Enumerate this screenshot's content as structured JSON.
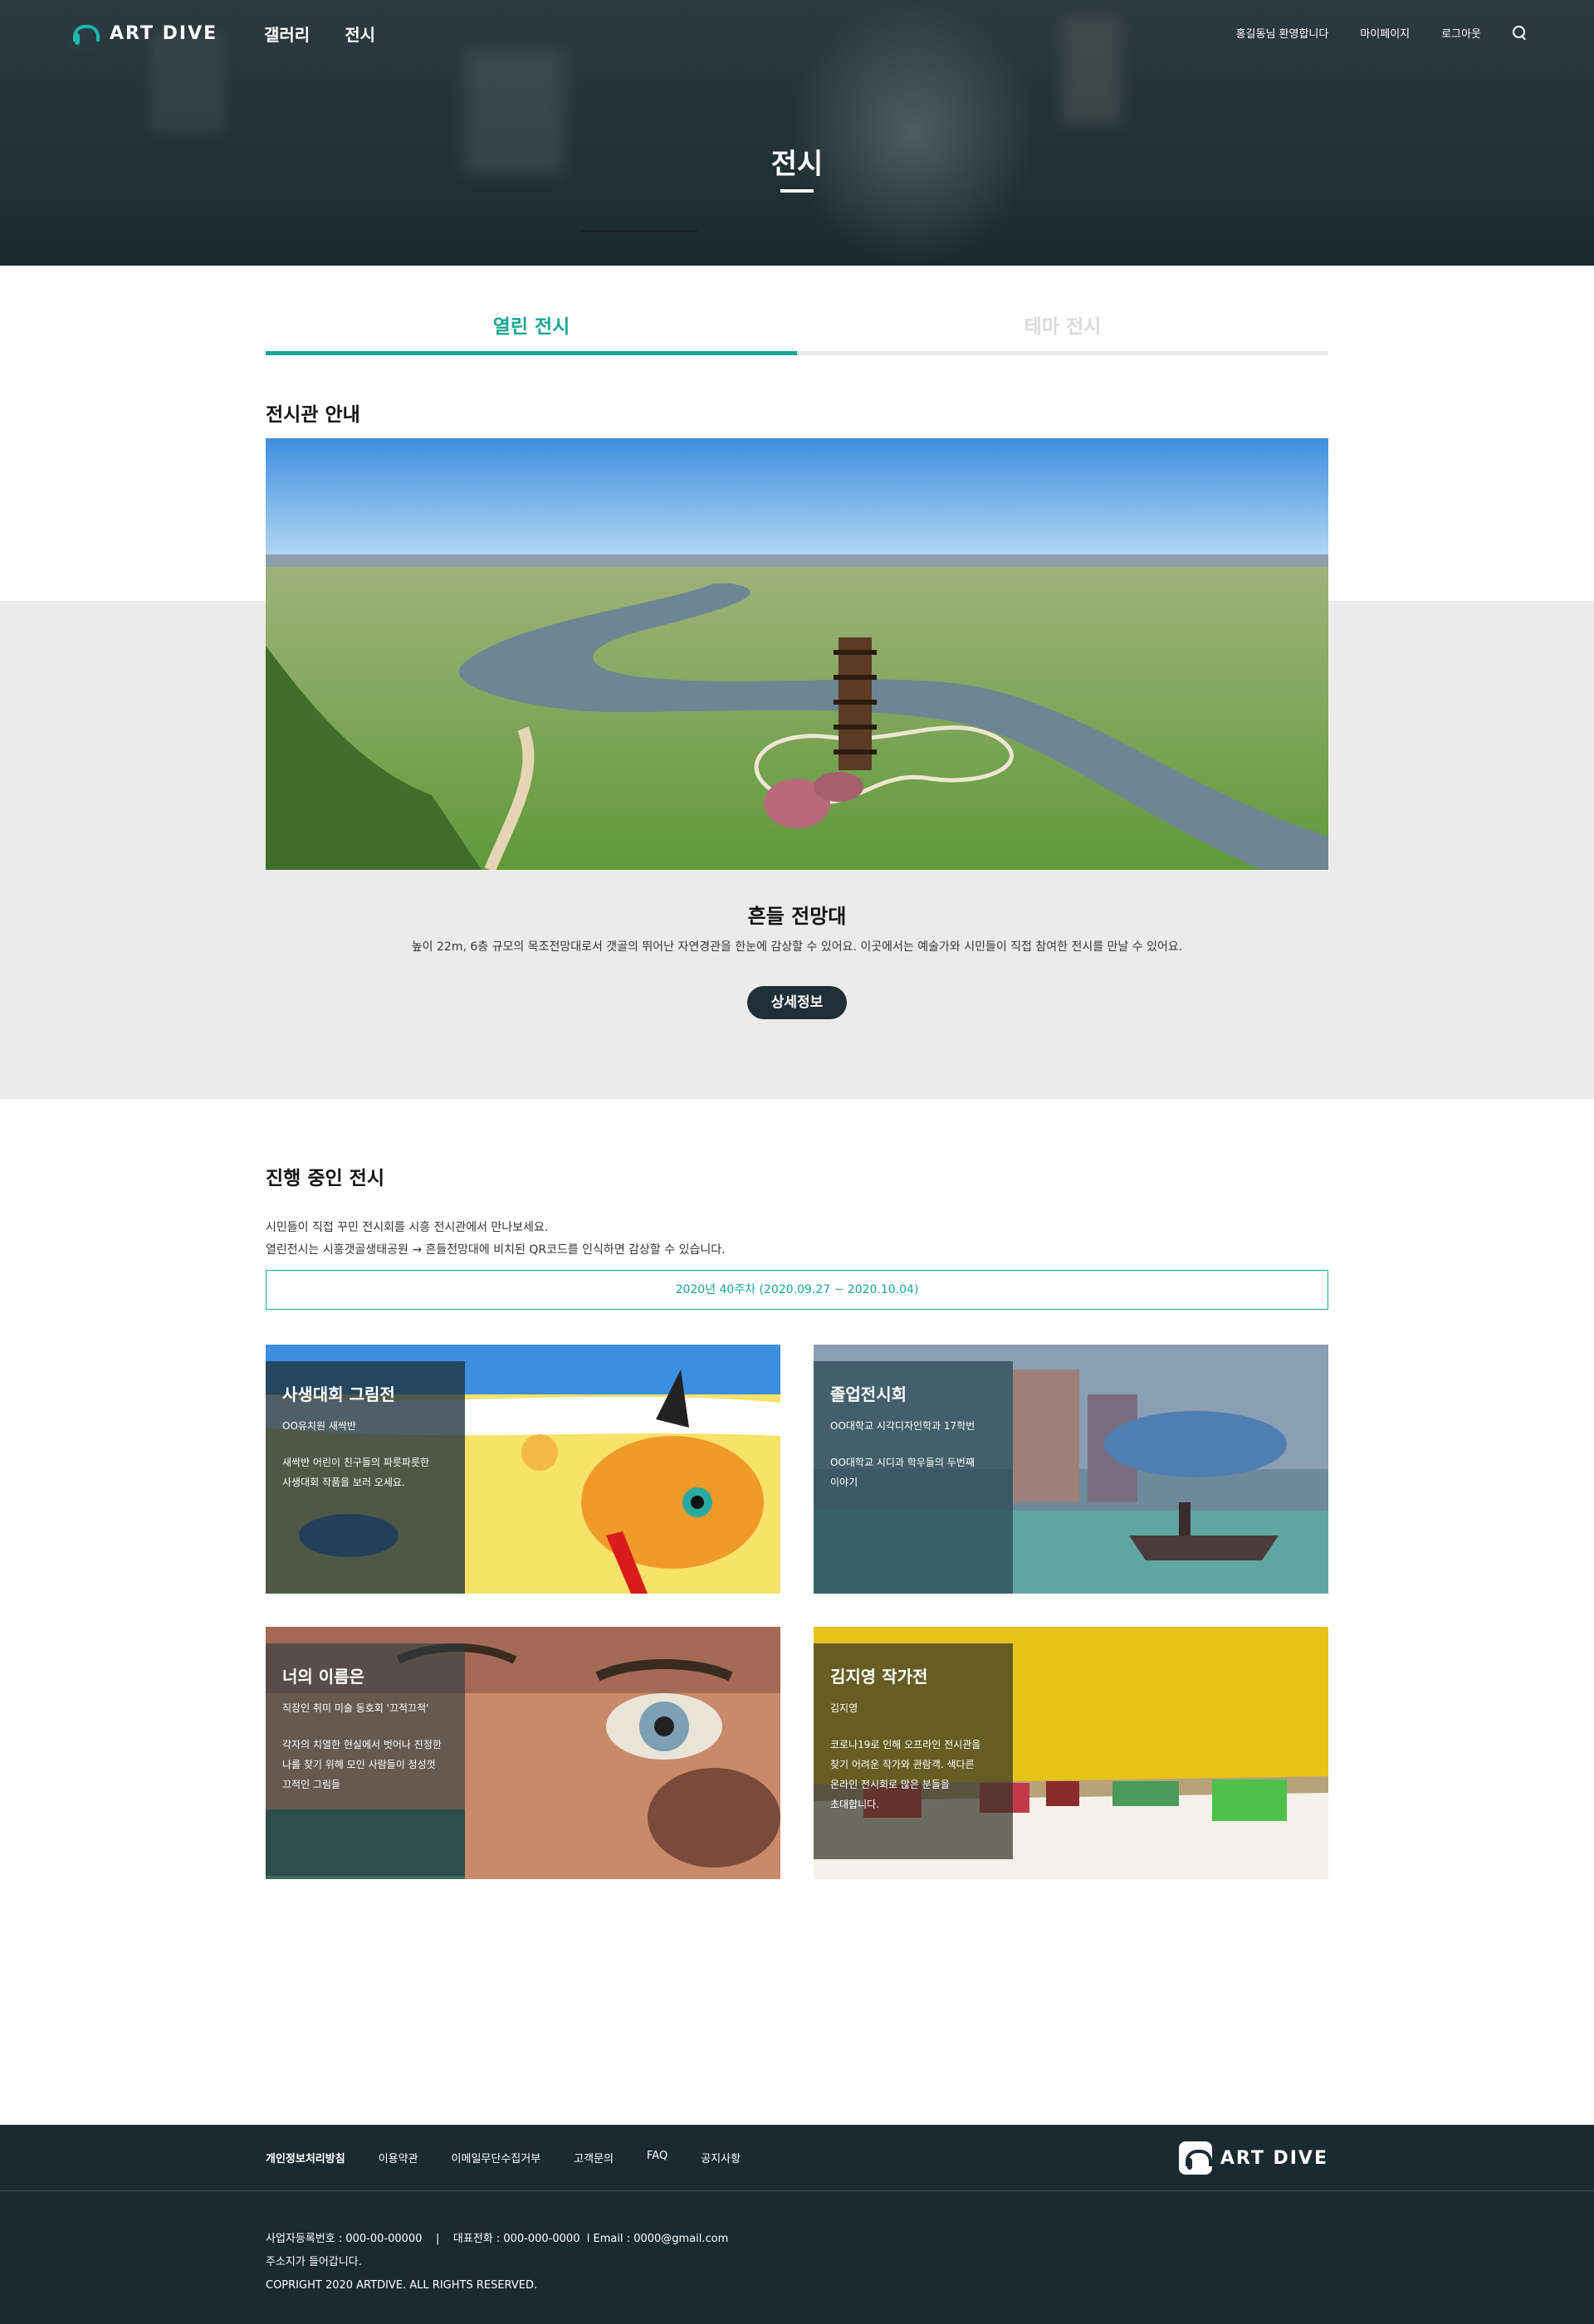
{
  "header": {
    "logo_text": "ART DIVE",
    "nav": [
      "갤러리",
      "전시"
    ],
    "util": {
      "welcome": "홍길동님 환영합니다",
      "mypage": "마이페이지",
      "logout": "로그아웃"
    },
    "hero_title": "전시"
  },
  "tabs": [
    {
      "label": "열린 전시",
      "active": true
    },
    {
      "label": "테마 전시",
      "active": false
    }
  ],
  "hall": {
    "section_title": "전시관 안내",
    "name": "흔들 전망대",
    "description": "높이 22m, 6층 규모의 목조전망대로서 갯골의 뛰어난 자연경관을 한눈에 감상할 수 있어요. 이곳에서는 예술가와 시민들이 직접 참여한 전시를 만날 수 있어요.",
    "detail_button": "상세정보"
  },
  "ongoing": {
    "section_title": "진행 중인 전시",
    "desc_line1": "시민들이 직접 꾸민 전시회를 시흥 전시관에서 만나보세요.",
    "desc_line2": "열린전시는 시흥갯골생태공원 → 흔들전망대에 비치된 QR코드를 인식하면 감상할 수 있습니다.",
    "week": "2020년 40주차 (2020.09.27 ~ 2020.10.04)",
    "cards": [
      {
        "title": "사생대회 그림전",
        "sub": "OO유치원 새싹반",
        "text1": "새싹반 어린이 친구들의 파릇파릇한",
        "text2": "사생대회 작품을 보러 오세요.",
        "text3": ""
      },
      {
        "title": "졸업전시회",
        "sub": "OO대학교 시각디자인학과 17학번",
        "text1": "OO대학교 시디과 학우들의 두번째",
        "text2": "이야기",
        "text3": ""
      },
      {
        "title": "너의 이름은",
        "sub": "직장인 취미 미술 동호회 '끄적끄적'",
        "text1": "각자의 치열한 현실에서 벗어나 진정한",
        "text2": "나를 찾기 위해 모인 사람들이 정성껏",
        "text3": "끄적인 그림들"
      },
      {
        "title": "김지영 작가전",
        "sub": "김지영",
        "text1": "코로나19로 인해 오프라인 전시관을",
        "text2": "찾기 어려운 작가와 관람객. 색다른",
        "text3": "온라인 전시회로 많은 분들을",
        "text4": "초대합니다."
      }
    ]
  },
  "footer": {
    "links": [
      "개인정보처리방침",
      "이용약관",
      "이메일무단수집거부",
      "고객문의",
      "FAQ",
      "공지사항"
    ],
    "logo_text": "ART DIVE",
    "biz_line": "사업자등록번호 : 000-00-00000    |    대표전화 : 000-000-0000  l Email : 0000@gmail.com",
    "address": "주소지가 들어갑니다.",
    "copyright": "COPRIGHT 2020 ARTDIVE. ALL RIGHTS RESERVED."
  },
  "colors": {
    "accent": "#16a694",
    "dark": "#1b2a31",
    "band": "#ebebeb"
  },
  "icons": [
    "logo-icon",
    "search-icon"
  ]
}
